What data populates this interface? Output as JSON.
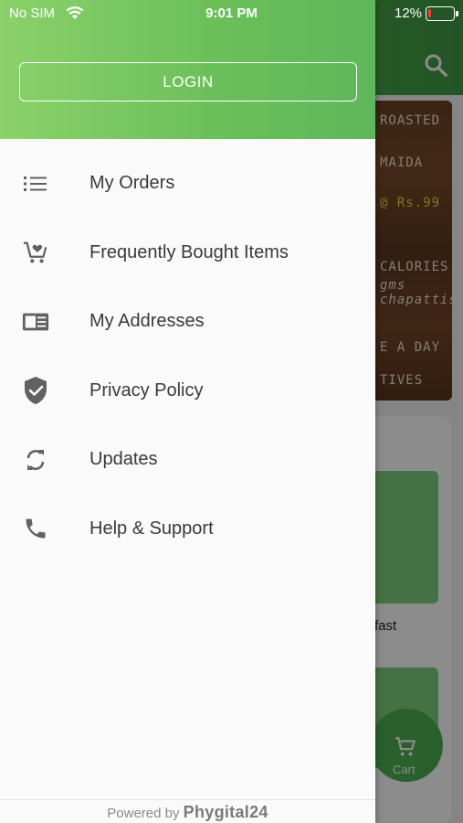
{
  "status_bar": {
    "carrier": "No SIM",
    "time": "9:01 PM",
    "battery_percent": "12%",
    "battery_level": 0.12
  },
  "drawer": {
    "login_label": "LOGIN",
    "menu_items": [
      {
        "label": "My Orders",
        "icon": "list-icon"
      },
      {
        "label": "Frequently Bought Items",
        "icon": "cart-heart-icon"
      },
      {
        "label": "My Addresses",
        "icon": "address-card-icon"
      },
      {
        "label": "Privacy Policy",
        "icon": "shield-check-icon"
      },
      {
        "label": "Updates",
        "icon": "sync-icon"
      },
      {
        "label": "Help & Support",
        "icon": "phone-icon"
      }
    ],
    "footer": {
      "prefix": "Powered by",
      "brand": "Phygital24"
    }
  },
  "background": {
    "banner_lines": [
      "ROASTED",
      "MAIDA",
      "@ Rs.99",
      "CALORIES",
      "gms",
      "chapattis!",
      "E A DAY",
      "TIVES"
    ],
    "tile_label": "fast",
    "cart_label": "Cart"
  },
  "colors": {
    "header_green": "#6cc05a",
    "fab_green": "#4caf50",
    "drawer_bg": "#fafafa",
    "icon_grey": "#616161"
  }
}
